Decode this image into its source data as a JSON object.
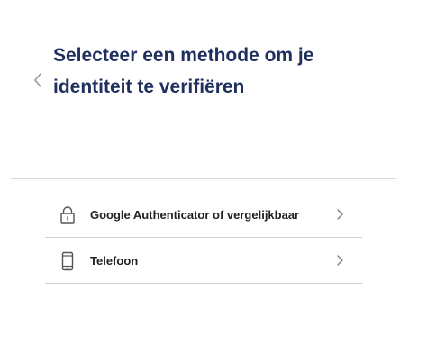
{
  "header": {
    "title_line1": "Selecteer een methode om je",
    "title_line2": "identiteit te verifiëren",
    "back_icon": "chevron-left-icon"
  },
  "methods": [
    {
      "label": "Google Authenticator of vergelijkbaar",
      "icon": "lock-icon"
    },
    {
      "label": "Telefoon",
      "icon": "mobile-phone-icon"
    }
  ],
  "colors": {
    "title": "#1f2f5e",
    "label": "#222222",
    "divider": "#d9d9d9",
    "icon": "#555555",
    "chevron": "#7a7a7a"
  }
}
